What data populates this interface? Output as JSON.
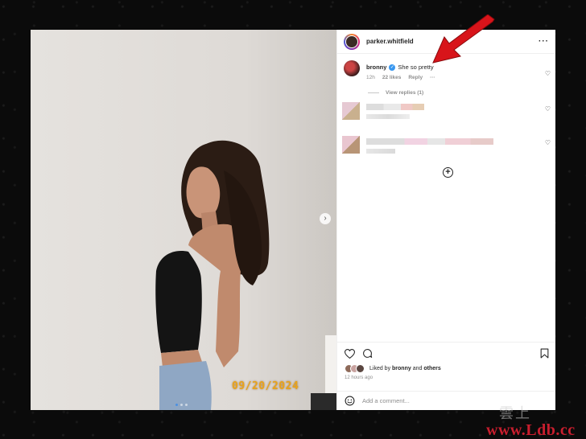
{
  "post": {
    "username": "parker.whitfield",
    "photo": {
      "date_stamp": "09/20/2024",
      "carousel": {
        "total": 3,
        "active": 1
      }
    }
  },
  "comment": {
    "user": "bronny",
    "verified": true,
    "text": "She so pretty",
    "time": "12h",
    "likes": "22 likes",
    "reply": "Reply",
    "view_replies": "View replies (1)"
  },
  "actions": {
    "liked_prefix": "Liked by",
    "liked_user": "bronny",
    "liked_and": "and",
    "liked_others": "others",
    "time_ago": "12 hours ago",
    "add_comment_placeholder": "Add a comment..."
  },
  "watermark": {
    "cjk": "雲上",
    "url": "www.Ldb.cc"
  },
  "icons": {
    "more": "more-horizontal-icon",
    "heart": "heart-icon",
    "comment": "comment-bubble-icon",
    "bookmark": "bookmark-icon",
    "add": "plus-circle-icon",
    "emoji": "emoji-icon",
    "next": "chevron-right-icon",
    "verified": "verified-badge-icon"
  },
  "colors": {
    "annotation_arrow": "#d8141a",
    "verified_blue": "#3897f0",
    "date_stamp": "#e8a31b",
    "watermark_url": "#c81e2e"
  }
}
